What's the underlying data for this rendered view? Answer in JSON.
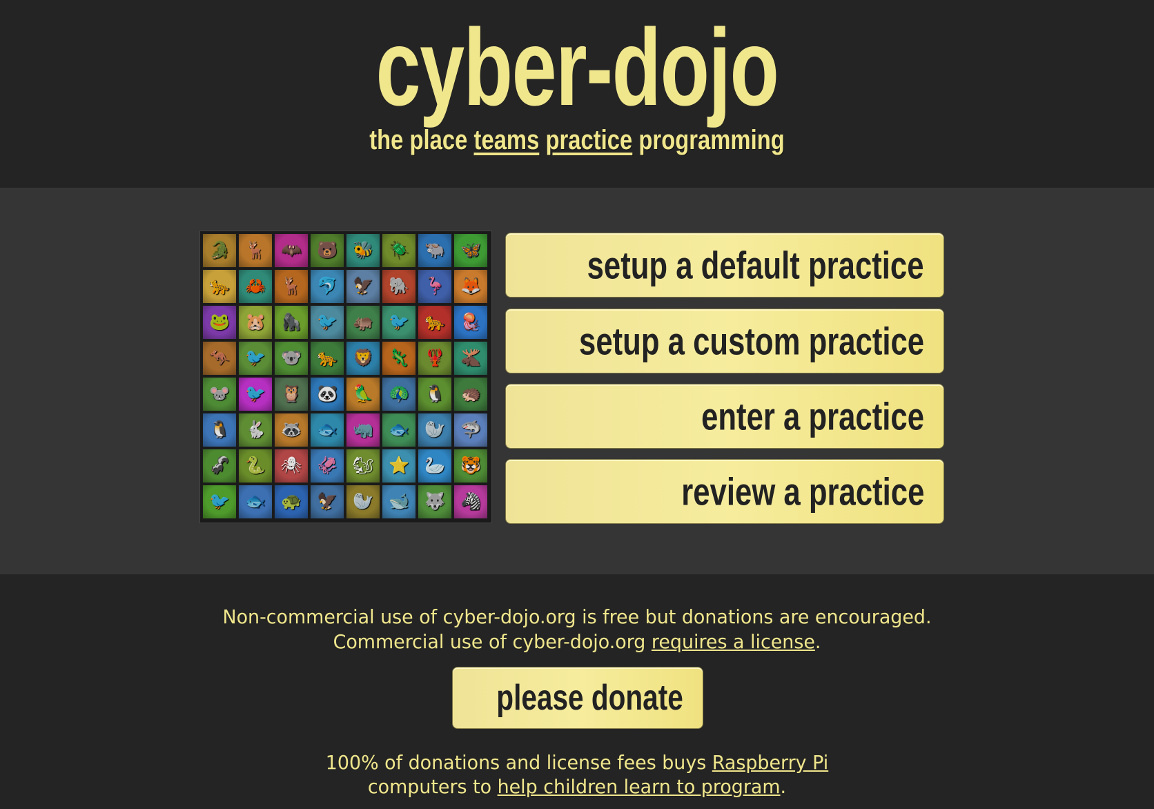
{
  "header": {
    "logo": "cyber-dojo",
    "tagline_prefix": "the place",
    "tagline_link1": "teams",
    "tagline_link2": "practice",
    "tagline_suffix": "programming"
  },
  "menu": [
    {
      "label": "setup a default practice"
    },
    {
      "label": "setup a custom practice"
    },
    {
      "label": "enter a practice"
    },
    {
      "label": "review a practice"
    }
  ],
  "animals": [
    {
      "name": "crocodile",
      "glyph": "🐊",
      "color": "#a87d2c"
    },
    {
      "name": "antelope",
      "glyph": "🦌",
      "color": "#b9762a"
    },
    {
      "name": "bat",
      "glyph": "🦇",
      "color": "#b22c8a"
    },
    {
      "name": "bear",
      "glyph": "🐻",
      "color": "#4f7d2b"
    },
    {
      "name": "bee",
      "glyph": "🐝",
      "color": "#2f8a7a"
    },
    {
      "name": "beetle",
      "glyph": "🪲",
      "color": "#6e8a2a"
    },
    {
      "name": "buffalo",
      "glyph": "🐃",
      "color": "#2c6fae"
    },
    {
      "name": "butterfly",
      "glyph": "🦋",
      "color": "#3e9b34"
    },
    {
      "name": "cheetah",
      "glyph": "🐆",
      "color": "#c8a13a"
    },
    {
      "name": "crab",
      "glyph": "🦀",
      "color": "#2f8a77"
    },
    {
      "name": "deer",
      "glyph": "🦌",
      "color": "#b5661f"
    },
    {
      "name": "dolphin",
      "glyph": "🐬",
      "color": "#3c86b4"
    },
    {
      "name": "eagle",
      "glyph": "🦅",
      "color": "#5c7fa3"
    },
    {
      "name": "elephant",
      "glyph": "🐘",
      "color": "#b0432b"
    },
    {
      "name": "flamingo",
      "glyph": "🦩",
      "color": "#3f5fa8"
    },
    {
      "name": "fox",
      "glyph": "🦊",
      "color": "#c97a2c"
    },
    {
      "name": "frog",
      "glyph": "🐸",
      "color": "#7c3aa8"
    },
    {
      "name": "gopher",
      "glyph": "🐹",
      "color": "#8fa437"
    },
    {
      "name": "gorilla",
      "glyph": "🦍",
      "color": "#6a9d2b"
    },
    {
      "name": "heron",
      "glyph": "🐦",
      "color": "#4d8a9e"
    },
    {
      "name": "hippo",
      "glyph": "🦛",
      "color": "#3f7f4a"
    },
    {
      "name": "hummingbird",
      "glyph": "🐦",
      "color": "#3b8f6e"
    },
    {
      "name": "hyena",
      "glyph": "🐆",
      "color": "#b3302a"
    },
    {
      "name": "jellyfish",
      "glyph": "🪼",
      "color": "#2c73c4"
    },
    {
      "name": "kangaroo",
      "glyph": "🦘",
      "color": "#a66b2a"
    },
    {
      "name": "kingfisher",
      "glyph": "🐦",
      "color": "#5a8d36"
    },
    {
      "name": "koala",
      "glyph": "🐨",
      "color": "#4f8d33"
    },
    {
      "name": "leopard",
      "glyph": "🐆",
      "color": "#3d7b3b"
    },
    {
      "name": "lion",
      "glyph": "🦁",
      "color": "#2c7fa8"
    },
    {
      "name": "lizard",
      "glyph": "🦎",
      "color": "#b7641c"
    },
    {
      "name": "lobster",
      "glyph": "🦞",
      "color": "#6b8a2f"
    },
    {
      "name": "moose",
      "glyph": "🫎",
      "color": "#2f8c6d"
    },
    {
      "name": "mouse",
      "glyph": "🐭",
      "color": "#4e8b35"
    },
    {
      "name": "ostrich",
      "glyph": "🐦",
      "color": "#b52fc0"
    },
    {
      "name": "owl",
      "glyph": "🦉",
      "color": "#4f6f4f"
    },
    {
      "name": "panda",
      "glyph": "🐼",
      "color": "#2d77b7"
    },
    {
      "name": "parrot",
      "glyph": "🦜",
      "color": "#b97a2a"
    },
    {
      "name": "peacock",
      "glyph": "🦚",
      "color": "#3f6f9f"
    },
    {
      "name": "penguin",
      "glyph": "🐧",
      "color": "#5c8f2f"
    },
    {
      "name": "porcupine",
      "glyph": "🦔",
      "color": "#3d7a3c"
    },
    {
      "name": "puffin",
      "glyph": "🐧",
      "color": "#3c74b6"
    },
    {
      "name": "rabbit",
      "glyph": "🐇",
      "color": "#5f8d34"
    },
    {
      "name": "raccoon",
      "glyph": "🦝",
      "color": "#b6782a"
    },
    {
      "name": "ray",
      "glyph": "🐟",
      "color": "#2e88a9"
    },
    {
      "name": "rhino",
      "glyph": "🦏",
      "color": "#b43097"
    },
    {
      "name": "salmon",
      "glyph": "🐟",
      "color": "#3f8d56"
    },
    {
      "name": "seal",
      "glyph": "🦭",
      "color": "#3c7eac"
    },
    {
      "name": "shark",
      "glyph": "🦈",
      "color": "#5b7fba"
    },
    {
      "name": "skunk",
      "glyph": "🦨",
      "color": "#4d8b30"
    },
    {
      "name": "snake",
      "glyph": "🐍",
      "color": "#6a8d2a"
    },
    {
      "name": "spider",
      "glyph": "🕷",
      "color": "#b04646"
    },
    {
      "name": "squid",
      "glyph": "🦑",
      "color": "#3a78b4"
    },
    {
      "name": "squirrel",
      "glyph": "🐿",
      "color": "#6f8d2f"
    },
    {
      "name": "starfish",
      "glyph": "⭐",
      "color": "#3c8fae"
    },
    {
      "name": "swan",
      "glyph": "🦢",
      "color": "#2f86c3"
    },
    {
      "name": "tiger",
      "glyph": "🐯",
      "color": "#4e8b35"
    },
    {
      "name": "toucan",
      "glyph": "🐦",
      "color": "#4e9b2b"
    },
    {
      "name": "tuna",
      "glyph": "🐟",
      "color": "#3c70b3"
    },
    {
      "name": "turtle",
      "glyph": "🐢",
      "color": "#2c63b0"
    },
    {
      "name": "vulture",
      "glyph": "🦅",
      "color": "#3f6e9f"
    },
    {
      "name": "walrus",
      "glyph": "🦭",
      "color": "#8a7a2a"
    },
    {
      "name": "whale",
      "glyph": "🐋",
      "color": "#3f83b4"
    },
    {
      "name": "wolf",
      "glyph": "🐺",
      "color": "#4f8d3a"
    },
    {
      "name": "zebra",
      "glyph": "🦓",
      "color": "#b53a9b"
    }
  ],
  "footer": {
    "line1": "Non-commercial use of cyber-dojo.org is free but donations are encouraged.",
    "line2_prefix": "Commercial use of cyber-dojo.org",
    "line2_link": "requires a license",
    "line2_suffix": ".",
    "donate_label": "please donate",
    "line3_prefix": "100% of donations and license fees buys",
    "line3_link": "Raspberry Pi",
    "line4_prefix": "computers to",
    "line4_link": "help children learn to program",
    "line4_suffix": "."
  },
  "colors": {
    "accent": "#f0e68c",
    "background": "#242424",
    "panel": "#353535",
    "button_text": "#222222"
  }
}
